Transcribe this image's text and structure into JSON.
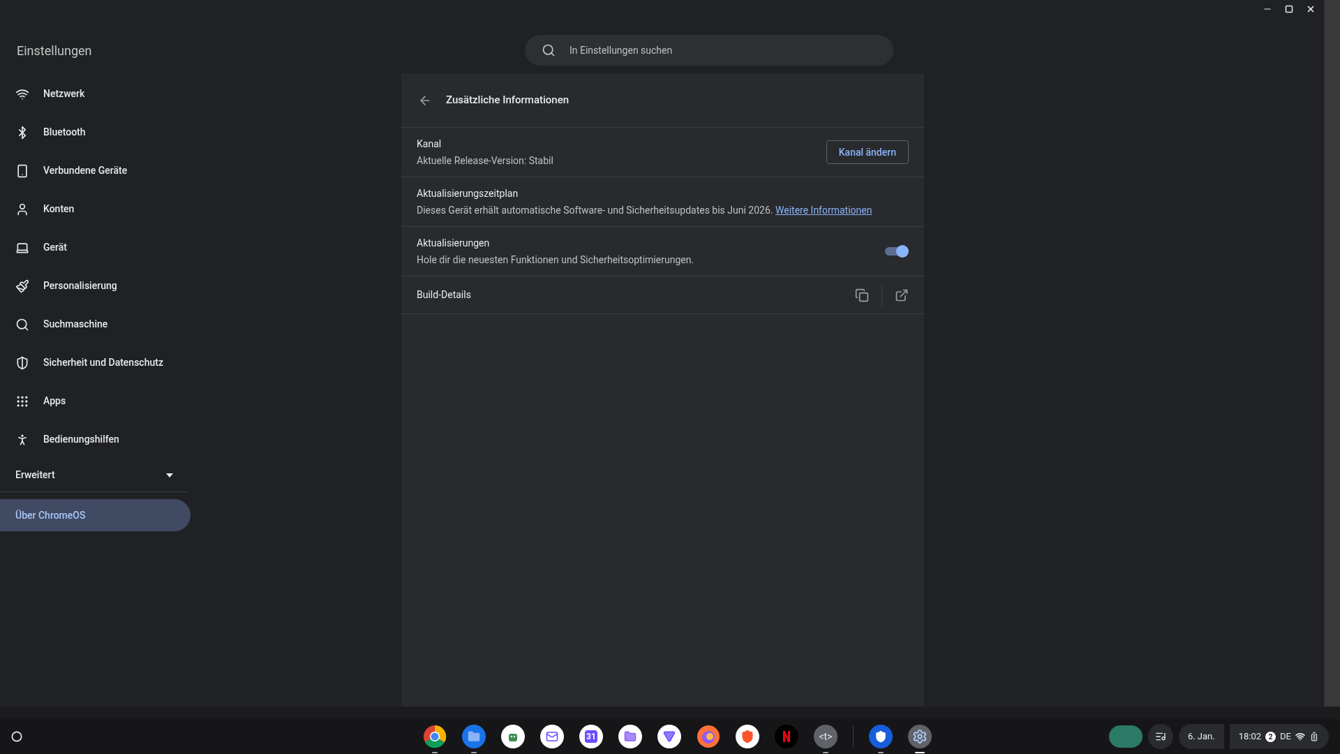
{
  "window": {
    "title": "Einstellungen"
  },
  "search": {
    "placeholder": "In Einstellungen suchen"
  },
  "sidebar": {
    "items": [
      {
        "label": "Netzwerk",
        "selected": false
      },
      {
        "label": "Bluetooth",
        "selected": false
      },
      {
        "label": "Verbundene Geräte",
        "selected": false
      },
      {
        "label": "Konten",
        "selected": false
      },
      {
        "label": "Gerät",
        "selected": false
      },
      {
        "label": "Personalisierung",
        "selected": false
      },
      {
        "label": "Suchmaschine",
        "selected": false
      },
      {
        "label": "Sicherheit und Datenschutz",
        "selected": false
      },
      {
        "label": "Apps",
        "selected": false
      },
      {
        "label": "Bedienungshilfen",
        "selected": false
      }
    ],
    "advanced": {
      "label": "Erweitert",
      "expanded": false
    },
    "about": {
      "label": "Über ChromeOS",
      "selected": true
    }
  },
  "page": {
    "title": "Zusätzliche Informationen",
    "rows": [
      {
        "kind": "button",
        "title": "Kanal",
        "subtitle": "Aktuelle Release-Version: Stabil",
        "button": "Kanal ändern"
      },
      {
        "kind": "link",
        "title": "Aktualisierungszeitplan",
        "subtitle": "Dieses Gerät erhält automatische Software- und Sicherheitsupdates bis Juni 2026.",
        "link": "Weitere Informationen"
      },
      {
        "kind": "toggle",
        "title": "Aktualisierungen",
        "subtitle": "Hole dir die neuesten Funktionen und Sicherheitsoptimierungen.",
        "on": true
      },
      {
        "kind": "actions",
        "title": "Build-Details"
      }
    ]
  },
  "shelf": {
    "apps": [
      {
        "running": true,
        "selected": false
      },
      {
        "running": true,
        "selected": false
      },
      {
        "running": false,
        "selected": false
      },
      {
        "running": false,
        "selected": false
      },
      {
        "running": false,
        "selected": false,
        "label": "31"
      },
      {
        "running": false,
        "selected": false
      },
      {
        "running": false,
        "selected": false
      },
      {
        "running": false,
        "selected": false
      },
      {
        "running": false,
        "selected": false
      },
      {
        "running": false,
        "selected": false
      },
      {
        "running": true,
        "selected": false,
        "label": "<t>"
      },
      {
        "running": true,
        "selected": false
      },
      {
        "running": true,
        "selected": true
      }
    ],
    "date": "6. Jan.",
    "time": "18:02",
    "notifications": "2",
    "keyboard": "DE"
  }
}
